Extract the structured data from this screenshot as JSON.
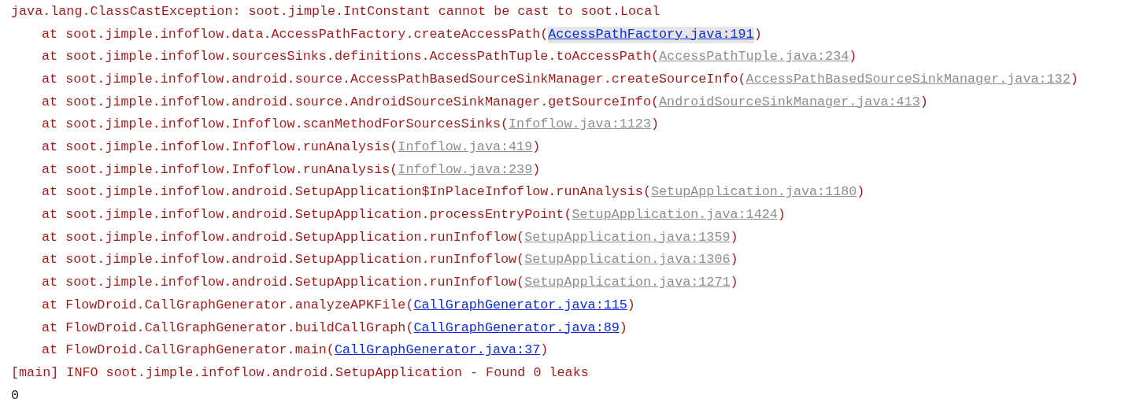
{
  "console": [
    {
      "kind": "exception",
      "text": "java.lang.ClassCastException: soot.jimple.IntConstant cannot be cast to soot.Local"
    },
    {
      "kind": "frame",
      "before": "at soot.jimple.infoflow.data.AccessPathFactory.createAccessPath(",
      "link": {
        "text": "AccessPathFactory.java:191",
        "color": "#0b2ad8",
        "highlighted": true
      },
      "after": ")"
    },
    {
      "kind": "frame",
      "before": "at soot.jimple.infoflow.sourcesSinks.definitions.AccessPathTuple.toAccessPath(",
      "link": {
        "text": "AccessPathTuple.java:234",
        "color": "#8e8e8e",
        "highlighted": false
      },
      "after": ")"
    },
    {
      "kind": "frame",
      "before": "at soot.jimple.infoflow.android.source.AccessPathBasedSourceSinkManager.createSourceInfo(",
      "link": {
        "text": "AccessPathBasedSourceSinkManager.java:132",
        "color": "#8e8e8e",
        "highlighted": false
      },
      "after": ")"
    },
    {
      "kind": "frame",
      "before": "at soot.jimple.infoflow.android.source.AndroidSourceSinkManager.getSourceInfo(",
      "link": {
        "text": "AndroidSourceSinkManager.java:413",
        "color": "#8e8e8e",
        "highlighted": false
      },
      "after": ")"
    },
    {
      "kind": "frame",
      "before": "at soot.jimple.infoflow.Infoflow.scanMethodForSourcesSinks(",
      "link": {
        "text": "Infoflow.java:1123",
        "color": "#8e8e8e",
        "highlighted": false
      },
      "after": ")"
    },
    {
      "kind": "frame",
      "before": "at soot.jimple.infoflow.Infoflow.runAnalysis(",
      "link": {
        "text": "Infoflow.java:419",
        "color": "#8e8e8e",
        "highlighted": false
      },
      "after": ")"
    },
    {
      "kind": "frame",
      "before": "at soot.jimple.infoflow.Infoflow.runAnalysis(",
      "link": {
        "text": "Infoflow.java:239",
        "color": "#8e8e8e",
        "highlighted": false
      },
      "after": ")"
    },
    {
      "kind": "frame",
      "before": "at soot.jimple.infoflow.android.SetupApplication$InPlaceInfoflow.runAnalysis(",
      "link": {
        "text": "SetupApplication.java:1180",
        "color": "#8e8e8e",
        "highlighted": false
      },
      "after": ")"
    },
    {
      "kind": "frame",
      "before": "at soot.jimple.infoflow.android.SetupApplication.processEntryPoint(",
      "link": {
        "text": "SetupApplication.java:1424",
        "color": "#8e8e8e",
        "highlighted": false
      },
      "after": ")"
    },
    {
      "kind": "frame",
      "before": "at soot.jimple.infoflow.android.SetupApplication.runInfoflow(",
      "link": {
        "text": "SetupApplication.java:1359",
        "color": "#8e8e8e",
        "highlighted": false
      },
      "after": ")"
    },
    {
      "kind": "frame",
      "before": "at soot.jimple.infoflow.android.SetupApplication.runInfoflow(",
      "link": {
        "text": "SetupApplication.java:1306",
        "color": "#8e8e8e",
        "highlighted": false
      },
      "after": ")"
    },
    {
      "kind": "frame",
      "before": "at soot.jimple.infoflow.android.SetupApplication.runInfoflow(",
      "link": {
        "text": "SetupApplication.java:1271",
        "color": "#8e8e8e",
        "highlighted": false
      },
      "after": ")"
    },
    {
      "kind": "frame",
      "before": "at FlowDroid.CallGraphGenerator.analyzeAPKFile(",
      "link": {
        "text": "CallGraphGenerator.java:115",
        "color": "#0b2ad8",
        "highlighted": false
      },
      "after": ")"
    },
    {
      "kind": "frame",
      "before": "at FlowDroid.CallGraphGenerator.buildCallGraph(",
      "link": {
        "text": "CallGraphGenerator.java:89",
        "color": "#0b2ad8",
        "highlighted": false
      },
      "after": ")"
    },
    {
      "kind": "frame",
      "before": "at FlowDroid.CallGraphGenerator.main(",
      "link": {
        "text": "CallGraphGenerator.java:37",
        "color": "#0b2ad8",
        "highlighted": false
      },
      "after": ")"
    },
    {
      "kind": "stderr",
      "text": "[main] INFO soot.jimple.infoflow.android.SetupApplication - Found 0 leaks"
    },
    {
      "kind": "stdout",
      "text": "0"
    }
  ]
}
